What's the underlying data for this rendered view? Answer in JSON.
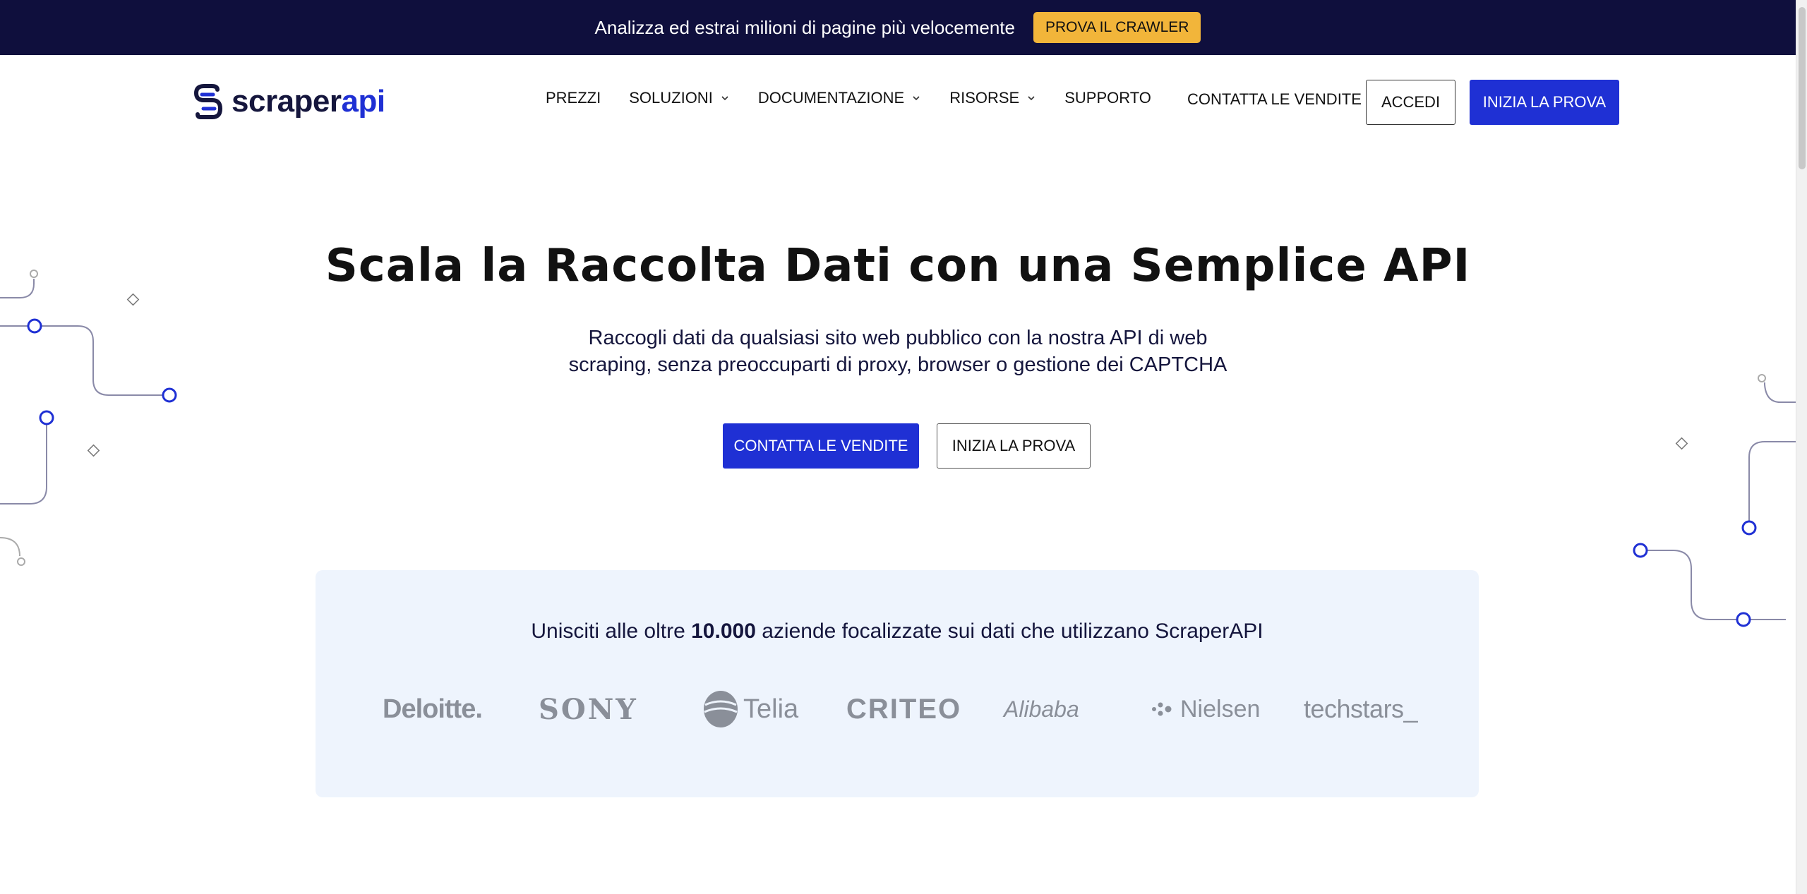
{
  "announcement": {
    "text": "Analizza ed estrai milioni di pagine più velocemente",
    "button": "PROVA IL CRAWLER",
    "background": "#0f0f3d",
    "button_color": "#f2b53a"
  },
  "nav": {
    "logo": {
      "text_main": "scraper",
      "text_accent": "api",
      "icon": "scraperapi-logo-icon"
    },
    "links": [
      {
        "label": "PREZZI",
        "has_dropdown": false
      },
      {
        "label": "SOLUZIONI",
        "has_dropdown": true
      },
      {
        "label": "DOCUMENTAZIONE",
        "has_dropdown": true
      },
      {
        "label": "RISORSE",
        "has_dropdown": true
      },
      {
        "label": "SUPPORTO",
        "has_dropdown": false
      }
    ],
    "contact_sales": "CONTATTA LE VENDITE",
    "login": "ACCEDI",
    "start_trial": "INIZIA LA PROVA"
  },
  "hero": {
    "title": "Scala la Raccolta Dati con una Semplice API",
    "subtitle": "Raccogli dati da qualsiasi sito web pubblico con la nostra API di web scraping, senza preoccuparti di proxy, browser o gestione dei CAPTCHA",
    "primary_button": "CONTATTA LE VENDITE",
    "secondary_button": "INIZIA LA PROVA"
  },
  "trust": {
    "prefix": "Unisciti alle oltre ",
    "count": "10.000",
    "suffix": " aziende focalizzate sui dati che utilizzano ScraperAPI",
    "logos": {
      "deloitte": "Deloitte.",
      "sony": "SONY",
      "telia": "Telia",
      "criteo": "CRITEO",
      "alibaba": "Alibaba",
      "nielsen": "Nielsen",
      "techstars": "techstars_"
    }
  },
  "colors": {
    "brand_blue": "#1f30d4",
    "dark_navy": "#15163d",
    "panel_bg": "#eef4fd",
    "logo_gray": "#8a8f99"
  }
}
